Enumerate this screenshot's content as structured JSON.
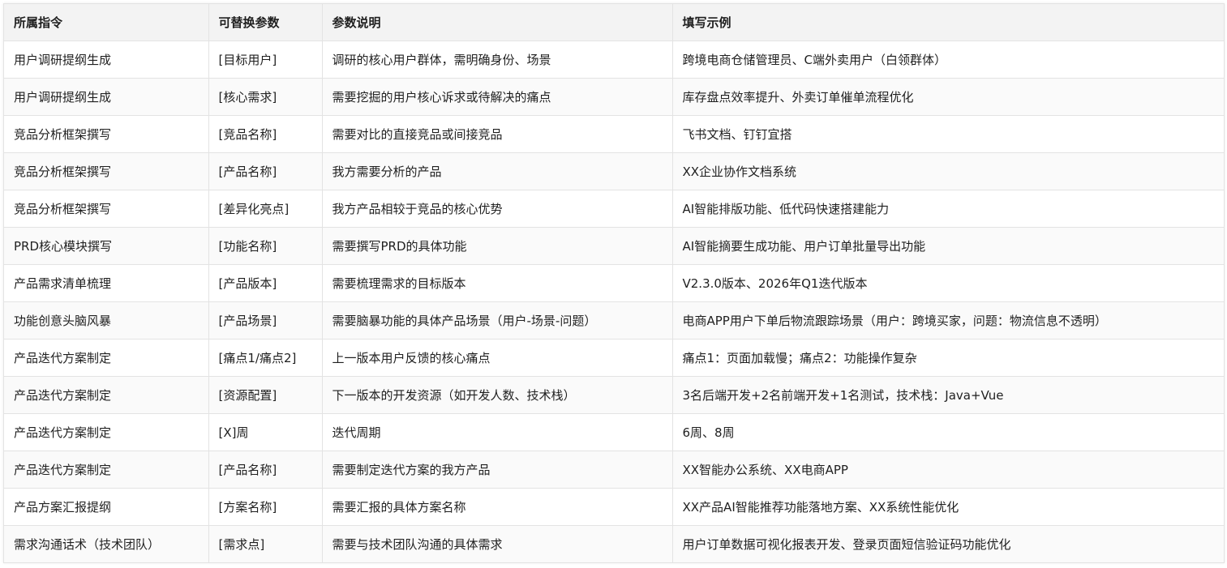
{
  "table": {
    "headers": [
      "所属指令",
      "可替换参数",
      "参数说明",
      "填写示例"
    ],
    "rows": [
      [
        "用户调研提纲生成",
        "[目标用户]",
        "调研的核心用户群体，需明确身份、场景",
        "跨境电商仓储管理员、C端外卖用户（白领群体）"
      ],
      [
        "用户调研提纲生成",
        "[核心需求]",
        "需要挖掘的用户核心诉求或待解决的痛点",
        "库存盘点效率提升、外卖订单催单流程优化"
      ],
      [
        "竞品分析框架撰写",
        "[竞品名称]",
        "需要对比的直接竞品或间接竞品",
        "飞书文档、钉钉宜搭"
      ],
      [
        "竞品分析框架撰写",
        "[产品名称]",
        "我方需要分析的产品",
        "XX企业协作文档系统"
      ],
      [
        "竞品分析框架撰写",
        "[差异化亮点]",
        "我方产品相较于竞品的核心优势",
        "AI智能排版功能、低代码快速搭建能力"
      ],
      [
        "PRD核心模块撰写",
        "[功能名称]",
        "需要撰写PRD的具体功能",
        "AI智能摘要生成功能、用户订单批量导出功能"
      ],
      [
        "产品需求清单梳理",
        "[产品版本]",
        "需要梳理需求的目标版本",
        "V2.3.0版本、2026年Q1迭代版本"
      ],
      [
        "功能创意头脑风暴",
        "[产品场景]",
        "需要脑暴功能的具体产品场景（用户-场景-问题）",
        "电商APP用户下单后物流跟踪场景（用户：跨境买家，问题：物流信息不透明）"
      ],
      [
        "产品迭代方案制定",
        "[痛点1/痛点2]",
        "上一版本用户反馈的核心痛点",
        "痛点1：页面加载慢；痛点2：功能操作复杂"
      ],
      [
        "产品迭代方案制定",
        "[资源配置]",
        "下一版本的开发资源（如开发人数、技术栈）",
        "3名后端开发+2名前端开发+1名测试，技术栈：Java+Vue"
      ],
      [
        "产品迭代方案制定",
        "[X]周",
        "迭代周期",
        "6周、8周"
      ],
      [
        "产品迭代方案制定",
        "[产品名称]",
        "需要制定迭代方案的我方产品",
        "XX智能办公系统、XX电商APP"
      ],
      [
        "产品方案汇报提纲",
        "[方案名称]",
        "需要汇报的具体方案名称",
        "XX产品AI智能推荐功能落地方案、XX系统性能优化"
      ],
      [
        "需求沟通话术（技术团队）",
        "[需求点]",
        "需要与技术团队沟通的具体需求",
        "用户订单数据可视化报表开发、登录页面短信验证码功能优化"
      ]
    ]
  }
}
